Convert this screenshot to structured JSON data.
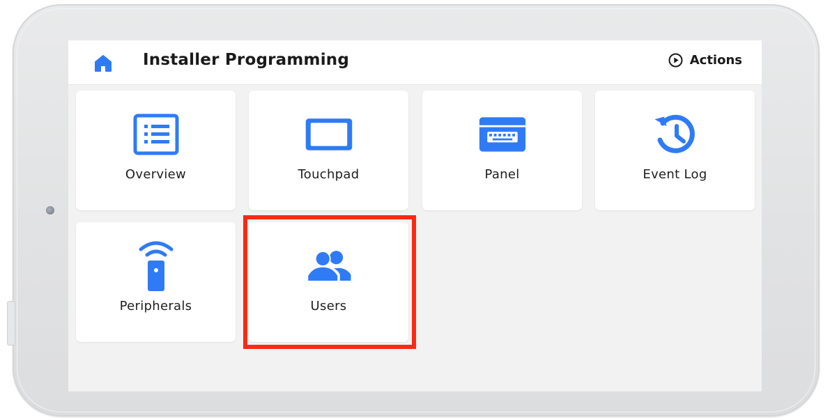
{
  "header": {
    "title": "Installer Programming",
    "actions_label": "Actions",
    "home_icon": "home-icon",
    "actions_icon": "play-circle-icon"
  },
  "tiles": [
    {
      "label": "Overview",
      "icon": "list-icon"
    },
    {
      "label": "Touchpad",
      "icon": "tablet-icon"
    },
    {
      "label": "Panel",
      "icon": "keypad-icon"
    },
    {
      "label": "Event Log",
      "icon": "history-icon"
    },
    {
      "label": "Peripherals",
      "icon": "remote-fob-icon"
    },
    {
      "label": "Users",
      "icon": "users-icon"
    }
  ],
  "colors": {
    "accent": "#2f7bf5",
    "highlight": "#fb2a10",
    "screen_bg": "#f2f2f2",
    "tile_bg": "#ffffff"
  }
}
